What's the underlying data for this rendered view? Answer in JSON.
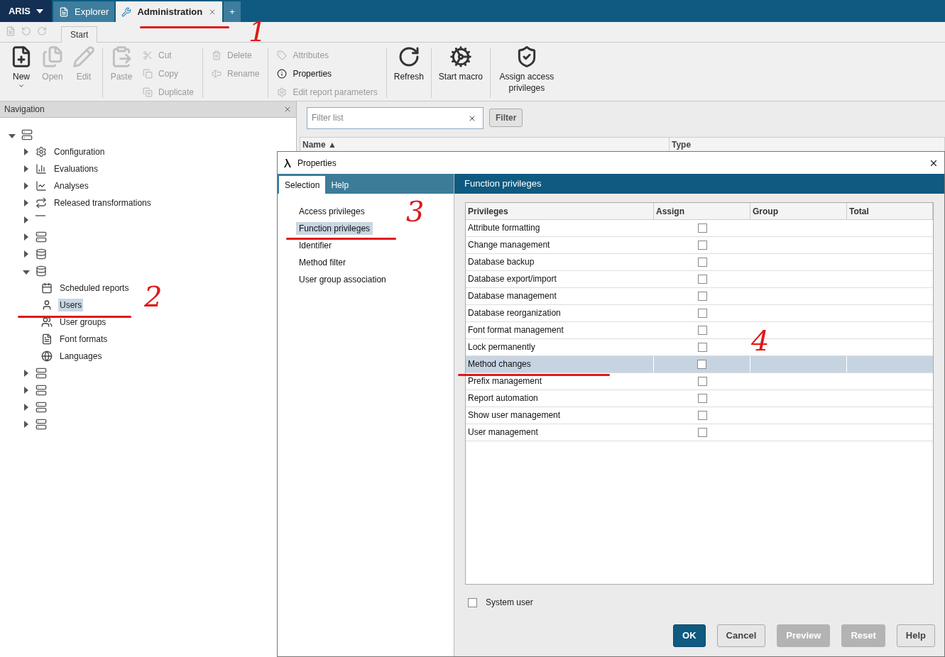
{
  "app_menu": {
    "label": "ARIS"
  },
  "tabs": [
    {
      "label": "Explorer",
      "selected": false,
      "closable": false
    },
    {
      "label": "Administration",
      "selected": true,
      "closable": true
    },
    {
      "label": "+",
      "selected": false,
      "closable": false
    }
  ],
  "ribbon_tab": {
    "label": "Start"
  },
  "ribbon": [
    {
      "kind": "large",
      "label": "New",
      "disabled": false,
      "dropdown": true
    },
    {
      "kind": "large",
      "label": "Open",
      "disabled": true
    },
    {
      "kind": "large",
      "label": "Edit",
      "disabled": true
    },
    {
      "kind": "separator"
    },
    {
      "kind": "large",
      "label": "Paste",
      "disabled": true
    },
    {
      "kind": "stack",
      "items": [
        {
          "label": "Cut",
          "disabled": true
        },
        {
          "label": "Copy",
          "disabled": true
        },
        {
          "label": "Duplicate",
          "disabled": true
        }
      ]
    },
    {
      "kind": "separator"
    },
    {
      "kind": "stack",
      "items": [
        {
          "label": "Delete",
          "disabled": true
        },
        {
          "label": "Rename",
          "disabled": true
        }
      ]
    },
    {
      "kind": "separator"
    },
    {
      "kind": "stack",
      "items": [
        {
          "label": "Attributes",
          "disabled": true
        },
        {
          "label": "Properties",
          "disabled": false
        },
        {
          "label": "Edit report parameters",
          "disabled": true
        }
      ]
    },
    {
      "kind": "separator"
    },
    {
      "kind": "large",
      "label": "Refresh",
      "disabled": false
    },
    {
      "kind": "separator"
    },
    {
      "kind": "large",
      "label": "Start macro",
      "disabled": false
    },
    {
      "kind": "separator"
    },
    {
      "kind": "large",
      "label": "Assign access privileges",
      "disabled": false
    }
  ],
  "navigation": {
    "title": "Navigation",
    "tree": [
      {
        "expanded": true,
        "children": [
          {
            "label": "Configuration",
            "expanded": false,
            "selected": false
          },
          {
            "label": "Evaluations",
            "expanded": false,
            "selected": false
          },
          {
            "label": "Analyses",
            "expanded": false,
            "selected": false
          },
          {
            "label": "Released transformations",
            "expanded": false,
            "selected": false
          },
          {
            "expanded": false
          },
          {
            "expanded": false
          },
          {
            "expanded": false
          },
          {
            "expanded": true,
            "children": [
              {
                "label": "Scheduled reports",
                "selected": false
              },
              {
                "label": "Users",
                "selected": true
              },
              {
                "label": "User groups",
                "selected": false
              },
              {
                "label": "Font formats",
                "selected": false
              },
              {
                "label": "Languages",
                "selected": false
              }
            ]
          },
          {
            "expanded": false
          },
          {
            "expanded": false
          },
          {
            "expanded": false
          },
          {
            "expanded": false
          }
        ]
      }
    ]
  },
  "filter": {
    "placeholder": "Filter list",
    "button": "Filter"
  },
  "list_columns": [
    "Name ▲",
    "Type"
  ],
  "dialog": {
    "title": "Properties",
    "side_tabs": [
      {
        "label": "Selection",
        "selected": true
      },
      {
        "label": "Help",
        "selected": false
      }
    ],
    "pages": [
      {
        "label": "Access privileges",
        "selected": false
      },
      {
        "label": "Function privileges",
        "selected": true
      },
      {
        "label": "Identifier",
        "selected": false
      },
      {
        "label": "Method filter",
        "selected": false
      },
      {
        "label": "User group association",
        "selected": false
      }
    ],
    "page_title": "Function privileges",
    "columns": [
      "Privileges",
      "Assign",
      "Group",
      "Total"
    ],
    "rows": [
      {
        "name": "Attribute formatting",
        "checked": false,
        "selected": false
      },
      {
        "name": "Change management",
        "checked": false,
        "selected": false
      },
      {
        "name": "Database backup",
        "checked": false,
        "selected": false
      },
      {
        "name": "Database export/import",
        "checked": false,
        "selected": false
      },
      {
        "name": "Database management",
        "checked": false,
        "selected": false
      },
      {
        "name": "Database reorganization",
        "checked": false,
        "selected": false
      },
      {
        "name": "Font format management",
        "checked": false,
        "selected": false
      },
      {
        "name": "Lock permanently",
        "checked": false,
        "selected": false
      },
      {
        "name": "Method changes",
        "checked": false,
        "selected": true
      },
      {
        "name": "Prefix management",
        "checked": false,
        "selected": false
      },
      {
        "name": "Report automation",
        "checked": false,
        "selected": false
      },
      {
        "name": "Show user management",
        "checked": false,
        "selected": false
      },
      {
        "name": "User management",
        "checked": false,
        "selected": false
      }
    ],
    "system_user": {
      "label": "System user",
      "checked": false
    },
    "buttons": [
      {
        "label": "OK",
        "kind": "primary",
        "disabled": false
      },
      {
        "label": "Cancel",
        "kind": "normal",
        "disabled": false
      },
      {
        "label": "Preview",
        "kind": "normal",
        "disabled": true
      },
      {
        "label": "Reset",
        "kind": "normal",
        "disabled": true
      },
      {
        "label": "Help",
        "kind": "normal",
        "disabled": false
      }
    ]
  },
  "annotations": [
    {
      "text": "1"
    },
    {
      "text": "2"
    },
    {
      "text": "3"
    },
    {
      "text": "4"
    }
  ]
}
